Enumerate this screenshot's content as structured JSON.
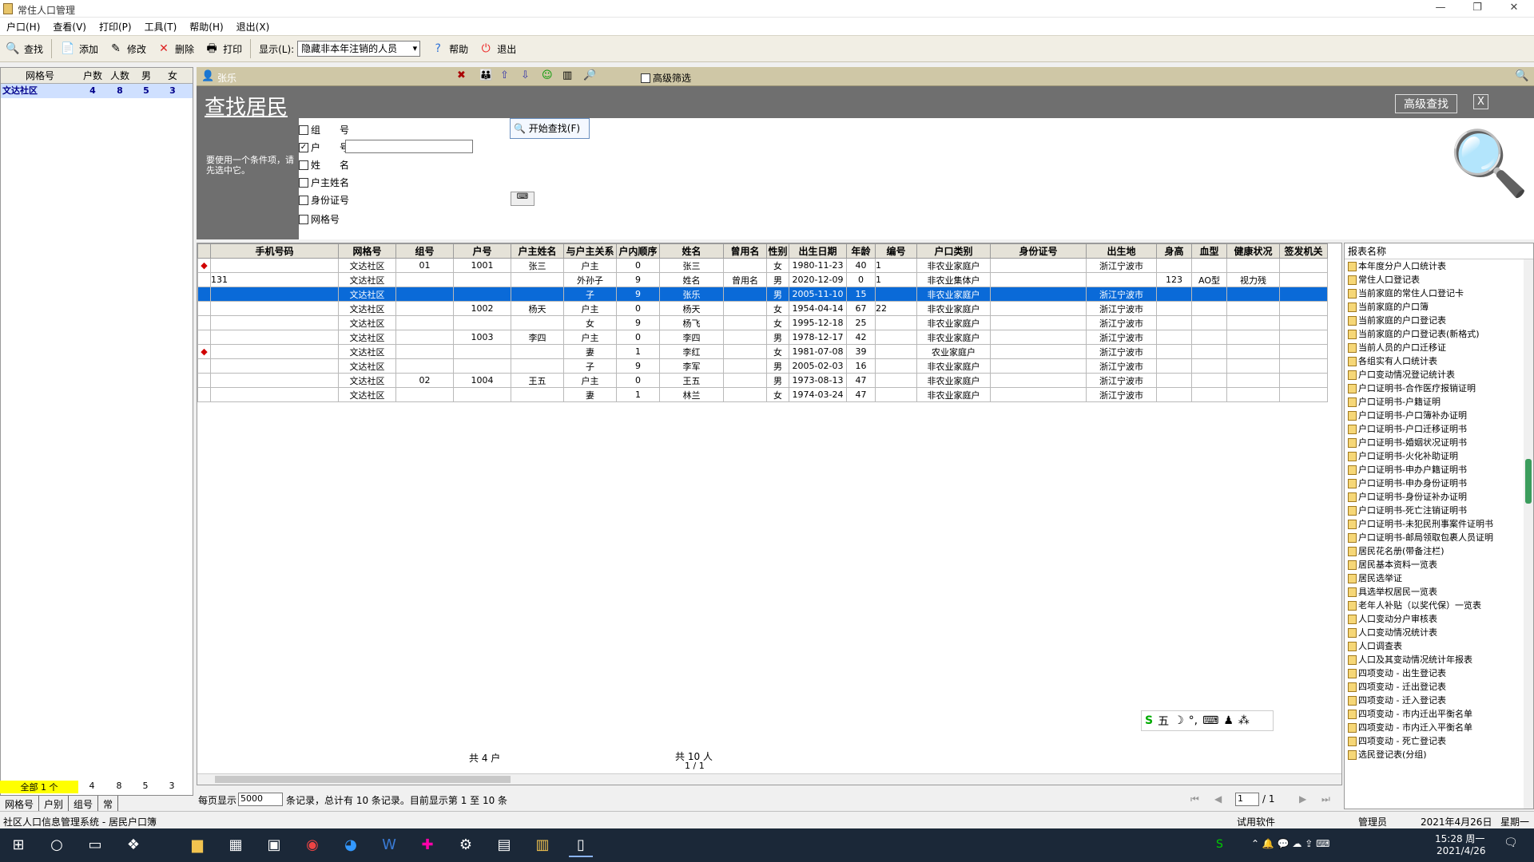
{
  "window": {
    "title": "常住人口管理"
  },
  "menu": [
    "户口(H)",
    "查看(V)",
    "打印(P)",
    "工具(T)",
    "帮助(H)",
    "退出(X)"
  ],
  "toolbar": {
    "find": "查找",
    "add": "添加",
    "edit": "修改",
    "delete": "删除",
    "print": "打印",
    "display_label": "显示(L):",
    "display_value": "隐藏非本年注销的人员",
    "help": "帮助",
    "exit": "退出"
  },
  "left": {
    "headers": [
      "网格号",
      "户数",
      "人数",
      "男",
      "女"
    ],
    "row": {
      "name": "文达社区",
      "hh": "4",
      "people": "8",
      "male": "5",
      "female": "3"
    },
    "total": {
      "label": "全部 1 个",
      "hh": "4",
      "people": "8",
      "male": "5",
      "female": "3"
    },
    "tabs": [
      "网格号",
      "户别",
      "组号",
      "常"
    ]
  },
  "subbar": {
    "person": "张乐",
    "advanced_filter": "高级筛选"
  },
  "search": {
    "title": "查找居民",
    "hint": "要使用一个条件项，请先选中它。",
    "start_btn": "开始查找(F)",
    "advanced_btn": "高级查找",
    "close": "X",
    "fields": [
      {
        "label": "组　　号",
        "checked": false
      },
      {
        "label": "户　　号",
        "checked": true
      },
      {
        "label": "姓　　名",
        "checked": false
      },
      {
        "label": "户主姓名",
        "checked": false
      },
      {
        "label": "身份证号",
        "checked": false
      },
      {
        "label": "网格号",
        "checked": false
      }
    ]
  },
  "grid": {
    "headers": [
      "",
      "手机号码",
      "网格号",
      "组号",
      "户号",
      "户主姓名",
      "与户主关系",
      "户内顺序",
      "姓名",
      "曾用名",
      "性别",
      "出生日期",
      "年龄",
      "编号",
      "户口类别",
      "身份证号",
      "出生地",
      "身高",
      "血型",
      "健康状况",
      "签发机关"
    ],
    "rows": [
      [
        "◆",
        "",
        "文达社区",
        "01",
        "1001",
        "张三",
        "户主",
        "0",
        "张三",
        "",
        "女",
        "1980-11-23",
        "40",
        "1",
        "非农业家庭户",
        "",
        "浙江宁波市",
        "",
        "",
        "",
        ""
      ],
      [
        "",
        "131",
        "文达社区",
        "",
        "",
        "",
        "外孙子",
        "9",
        "姓名",
        "曾用名",
        "男",
        "2020-12-09",
        "0",
        "1",
        "非农业集体户",
        "",
        "",
        "123",
        "AO型",
        "视力残",
        ""
      ],
      [
        "",
        "",
        "文达社区",
        "",
        "",
        "",
        "子",
        "9",
        "张乐",
        "",
        "男",
        "2005-11-10",
        "15",
        "",
        "非农业家庭户",
        "",
        "浙江宁波市",
        "",
        "",
        "",
        ""
      ],
      [
        "",
        "",
        "文达社区",
        "",
        "1002",
        "杨天",
        "户主",
        "0",
        "杨天",
        "",
        "女",
        "1954-04-14",
        "67",
        "22",
        "非农业家庭户",
        "",
        "浙江宁波市",
        "",
        "",
        "",
        ""
      ],
      [
        "",
        "",
        "文达社区",
        "",
        "",
        "",
        "女",
        "9",
        "杨飞",
        "",
        "女",
        "1995-12-18",
        "25",
        "",
        "非农业家庭户",
        "",
        "浙江宁波市",
        "",
        "",
        "",
        ""
      ],
      [
        "",
        "",
        "文达社区",
        "",
        "1003",
        "李四",
        "户主",
        "0",
        "李四",
        "",
        "男",
        "1978-12-17",
        "42",
        "",
        "非农业家庭户",
        "",
        "浙江宁波市",
        "",
        "",
        "",
        ""
      ],
      [
        "◆",
        "",
        "文达社区",
        "",
        "",
        "",
        "妻",
        "1",
        "李红",
        "",
        "女",
        "1981-07-08",
        "39",
        "",
        "农业家庭户",
        "",
        "浙江宁波市",
        "",
        "",
        "",
        ""
      ],
      [
        "",
        "",
        "文达社区",
        "",
        "",
        "",
        "子",
        "9",
        "李军",
        "",
        "男",
        "2005-02-03",
        "16",
        "",
        "非农业家庭户",
        "",
        "浙江宁波市",
        "",
        "",
        "",
        ""
      ],
      [
        "",
        "",
        "文达社区",
        "02",
        "1004",
        "王五",
        "户主",
        "0",
        "王五",
        "",
        "男",
        "1973-08-13",
        "47",
        "",
        "非农业家庭户",
        "",
        "浙江宁波市",
        "",
        "",
        "",
        ""
      ],
      [
        "",
        "",
        "文达社区",
        "",
        "",
        "",
        "妻",
        "1",
        "林兰",
        "",
        "女",
        "1974-03-24",
        "47",
        "",
        "非农业家庭户",
        "",
        "浙江宁波市",
        "",
        "",
        "",
        ""
      ]
    ],
    "selected_row": 2,
    "summary_households": "共 4 户",
    "summary_people": "共 10 人",
    "summary_pages": "1 / 1"
  },
  "pager": {
    "per_page_label": "每页显示",
    "per_page": "5000",
    "info": "条记录，总计有 10 条记录。目前显示第 1 至 10 条",
    "page": "1",
    "total": "/ 1"
  },
  "reports": {
    "header": "报表名称",
    "items": [
      "本年度分户人口统计表",
      "常住人口登记表",
      "当前家庭的常住人口登记卡",
      "当前家庭的户口簿",
      "当前家庭的户口登记表",
      "当前家庭的户口登记表(新格式)",
      "当前人员的户口迁移证",
      "各组实有人口统计表",
      "户口变动情况登记统计表",
      "户口证明书-合作医疗报销证明",
      "户口证明书-户籍证明",
      "户口证明书-户口簿补办证明",
      "户口证明书-户口迁移证明书",
      "户口证明书-婚姻状况证明书",
      "户口证明书-火化补助证明",
      "户口证明书-申办户籍证明书",
      "户口证明书-申办身份证明书",
      "户口证明书-身份证补办证明",
      "户口证明书-死亡注销证明书",
      "户口证明书-未犯民刑事案件证明书",
      "户口证明书-邮局领取包裹人员证明",
      "居民花名册(带备注栏)",
      "居民基本资料一览表",
      "居民选举证",
      "具选举权居民一览表",
      "老年人补贴（以奖代保）一览表",
      "人口变动分户审核表",
      "人口变动情况统计表",
      "人口调查表",
      "人口及其变动情况统计年报表",
      "四项变动 - 出生登记表",
      "四项变动 - 迁出登记表",
      "四项变动 - 迁入登记表",
      "四项变动 - 市内迁出平衡名单",
      "四项变动 - 市内迁入平衡名单",
      "四项变动 - 死亡登记表",
      "选民登记表(分组)"
    ]
  },
  "status": {
    "left": "社区人口信息管理系统 - 居民户口簿",
    "trial": "试用软件",
    "user": "管理员",
    "date": "2021年4月26日",
    "weekday": "星期一"
  },
  "taskbar": {
    "time": "15:28 周一",
    "date": "2021/4/26"
  },
  "ime": {
    "label": "五"
  }
}
